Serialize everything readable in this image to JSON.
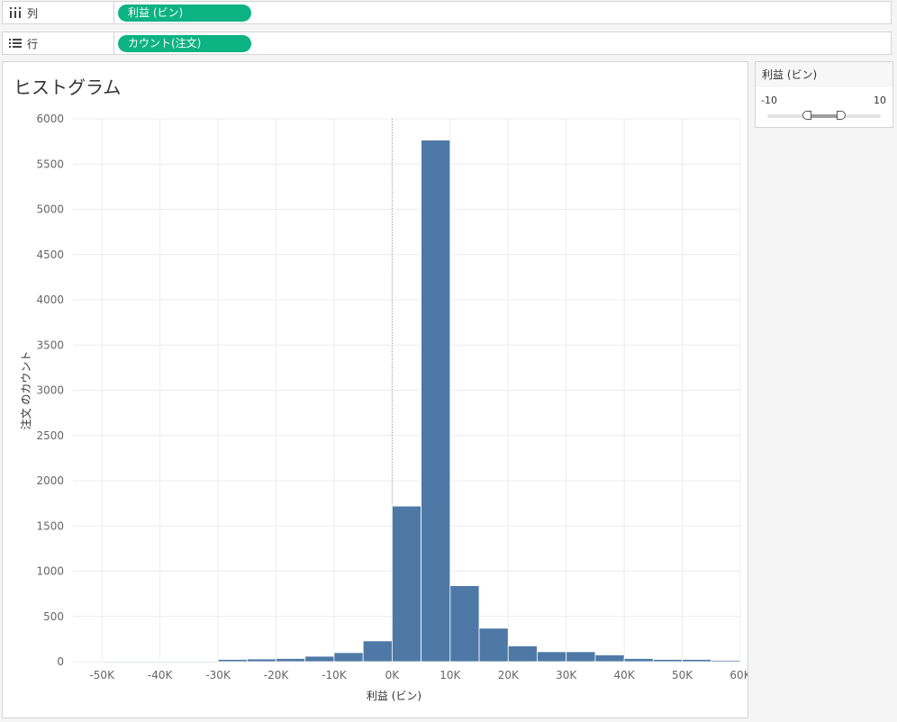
{
  "columns_shelf": {
    "label": "列",
    "icon": "columns-icon",
    "pill": "利益 (ビン)",
    "pill_color": "#0db382"
  },
  "rows_shelf": {
    "label": "行",
    "icon": "rows-icon",
    "pill": "カウント(注文)",
    "pill_color": "#0db382"
  },
  "chart": {
    "title": "ヒストグラム"
  },
  "filter": {
    "title": "利益 (ビン)",
    "min_label": "-10",
    "max_label": "10",
    "range": [
      -10,
      10
    ],
    "selected": [
      -3,
      3
    ]
  },
  "chart_data": {
    "type": "bar",
    "title": "ヒストグラム",
    "xlabel": "利益 (ビン)",
    "ylabel": "注文 のカウント",
    "bin_width": 5000,
    "bar_color": "#4e79a7",
    "xlim": [
      -55000,
      60000
    ],
    "ylim": [
      0,
      6000
    ],
    "x_ticks": [
      -50000,
      -40000,
      -30000,
      -20000,
      -10000,
      0,
      10000,
      20000,
      30000,
      40000,
      50000,
      60000
    ],
    "x_tick_labels": [
      "-50K",
      "-40K",
      "-30K",
      "-20K",
      "-10K",
      "0K",
      "10K",
      "20K",
      "30K",
      "40K",
      "50K",
      "60K"
    ],
    "y_ticks": [
      0,
      500,
      1000,
      1500,
      2000,
      2500,
      3000,
      3500,
      4000,
      4500,
      5000,
      5500,
      6000
    ],
    "y_tick_labels": [
      "0",
      "500",
      "1000",
      "1500",
      "2000",
      "2500",
      "3000",
      "3500",
      "4000",
      "4500",
      "5000",
      "5500",
      "6000"
    ],
    "grid": true,
    "bins": [
      {
        "x": -50000,
        "count": 3
      },
      {
        "x": -45000,
        "count": 3
      },
      {
        "x": -40000,
        "count": 3
      },
      {
        "x": -35000,
        "count": 3
      },
      {
        "x": -30000,
        "count": 25
      },
      {
        "x": -25000,
        "count": 30
      },
      {
        "x": -20000,
        "count": 35
      },
      {
        "x": -15000,
        "count": 60
      },
      {
        "x": -10000,
        "count": 100
      },
      {
        "x": -5000,
        "count": 230
      },
      {
        "x": 0,
        "count": 1720
      },
      {
        "x": 5000,
        "count": 5765
      },
      {
        "x": 10000,
        "count": 840
      },
      {
        "x": 15000,
        "count": 370
      },
      {
        "x": 20000,
        "count": 175
      },
      {
        "x": 25000,
        "count": 110
      },
      {
        "x": 30000,
        "count": 110
      },
      {
        "x": 35000,
        "count": 75
      },
      {
        "x": 40000,
        "count": 35
      },
      {
        "x": 45000,
        "count": 25
      },
      {
        "x": 50000,
        "count": 25
      },
      {
        "x": 55000,
        "count": 15
      }
    ]
  }
}
